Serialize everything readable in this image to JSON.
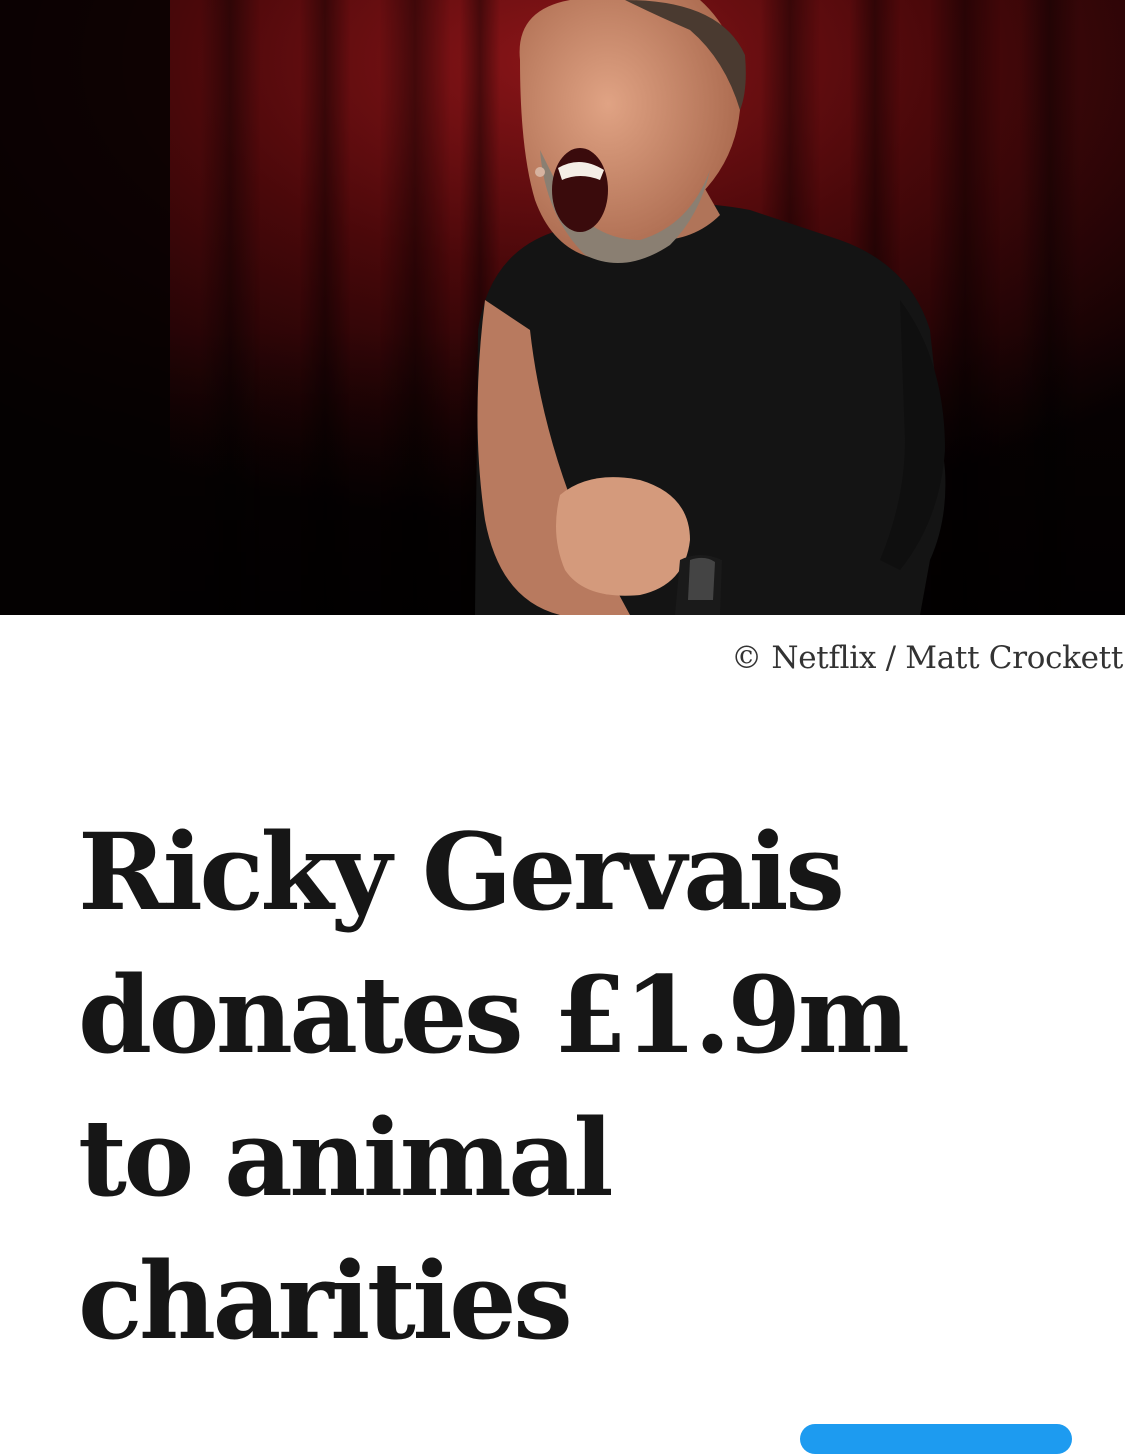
{
  "photo": {
    "subject": "Comedian performing on stage",
    "colors": {
      "background": "#0a0203",
      "curtain": "#6a0d10",
      "shirt": "#141414",
      "skin": "#c98a6a",
      "hair": "#8a7a6a"
    }
  },
  "credit": {
    "text": "© Netflix / Matt Crockett"
  },
  "headline": {
    "lines": [
      "Ricky Gervais",
      "donates £1.9m",
      "to animal",
      "charities"
    ]
  },
  "accent_color": "#1d9bf0"
}
